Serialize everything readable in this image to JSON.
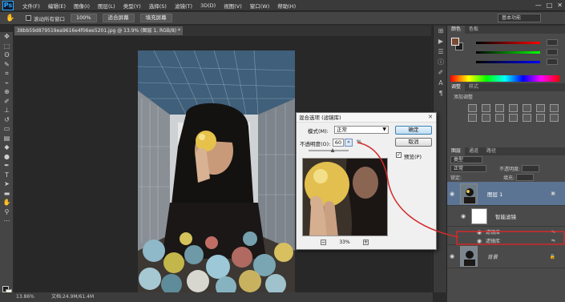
{
  "app": {
    "logo": "Ps"
  },
  "menu": [
    "文件(F)",
    "编辑(E)",
    "图像(I)",
    "图层(L)",
    "类型(Y)",
    "选择(S)",
    "滤镜(T)",
    "3D(D)",
    "视图(V)",
    "窗口(W)",
    "帮助(H)"
  ],
  "window_controls": [
    "—",
    "□",
    "✕"
  ],
  "options": {
    "scroll_all_label": "滚动所有窗口",
    "btn_zoom": "100%",
    "btn_fit": "适合屏幕",
    "btn_fill": "填充屏幕",
    "workspace": "基本功能"
  },
  "document": {
    "tab": "38bb59d879519ea9616e4f06ee5201.jpg @ 13.9% (图层 1, RGB/8) * ✕",
    "zoom": "13.86%",
    "doc_size": "文档:24.9M/61.4M"
  },
  "dialog": {
    "title": "混合选项 (滤镜库)",
    "mode_label": "模式(M):",
    "mode_value": "正常",
    "opacity_label": "不透明度(O):",
    "opacity_value": "60",
    "percent": "%",
    "ok": "确定",
    "cancel": "取消",
    "preview_label": "预览(P)",
    "preview_checked": "✓",
    "zoom": "33%",
    "zoom_minus": "−",
    "zoom_plus": "+",
    "opacity_fraction": 0.6
  },
  "panels": {
    "color_tabs": [
      "颜色",
      "色板"
    ],
    "color_values": [
      "",
      "",
      ""
    ],
    "adjust_tabs": [
      "调整",
      "样式"
    ],
    "adjust_hint": "添加调整",
    "layer_tabs": [
      "图层",
      "通道",
      "路径"
    ],
    "kind": "类型",
    "blend": "正常",
    "opacity_label": "不透明度:",
    "lock_label": "锁定:",
    "fill_label": "填充:",
    "layers": [
      {
        "name": "图层 1",
        "selected": true
      },
      {
        "name": "智能滤镜"
      },
      {
        "name": "滤镜库"
      },
      {
        "name": "滤镜库"
      },
      {
        "name": "背景"
      }
    ]
  },
  "colors": {
    "accent_red": "#d22b2b",
    "selection_blue": "#5c7493"
  }
}
